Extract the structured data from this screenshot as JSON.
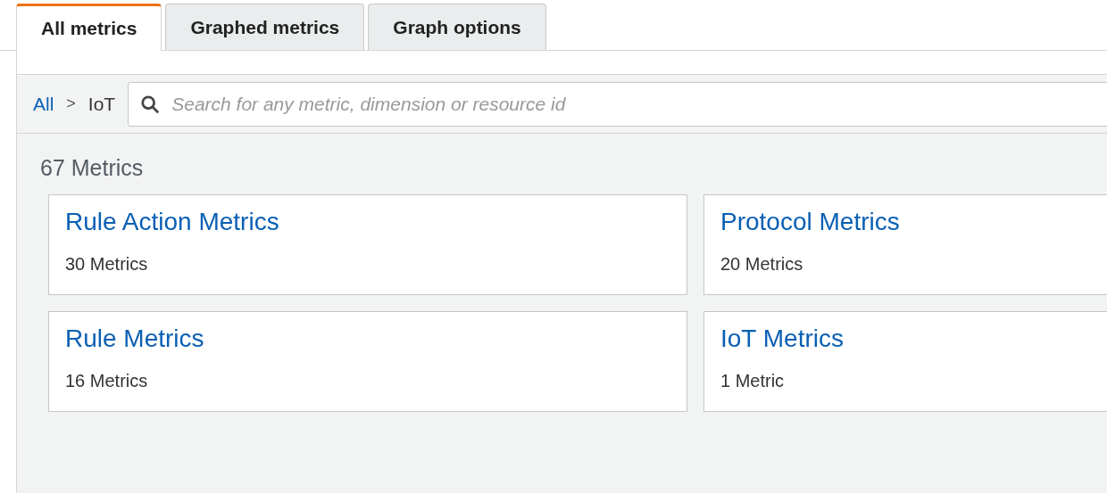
{
  "tabs": [
    {
      "label": "All metrics",
      "selected": true
    },
    {
      "label": "Graphed metrics",
      "selected": false
    },
    {
      "label": "Graph options",
      "selected": false
    }
  ],
  "breadcrumb": {
    "root": "All",
    "separator": ">",
    "current": "IoT"
  },
  "search": {
    "placeholder": "Search for any metric, dimension or resource id"
  },
  "metric_count": "67 Metrics",
  "namespaces": [
    {
      "title": "Rule Action Metrics",
      "count": "30 Metrics"
    },
    {
      "title": "Protocol Metrics",
      "count": "20 Metrics"
    },
    {
      "title": "Rule Metrics",
      "count": "16 Metrics"
    },
    {
      "title": "IoT Metrics",
      "count": "1 Metric"
    }
  ]
}
